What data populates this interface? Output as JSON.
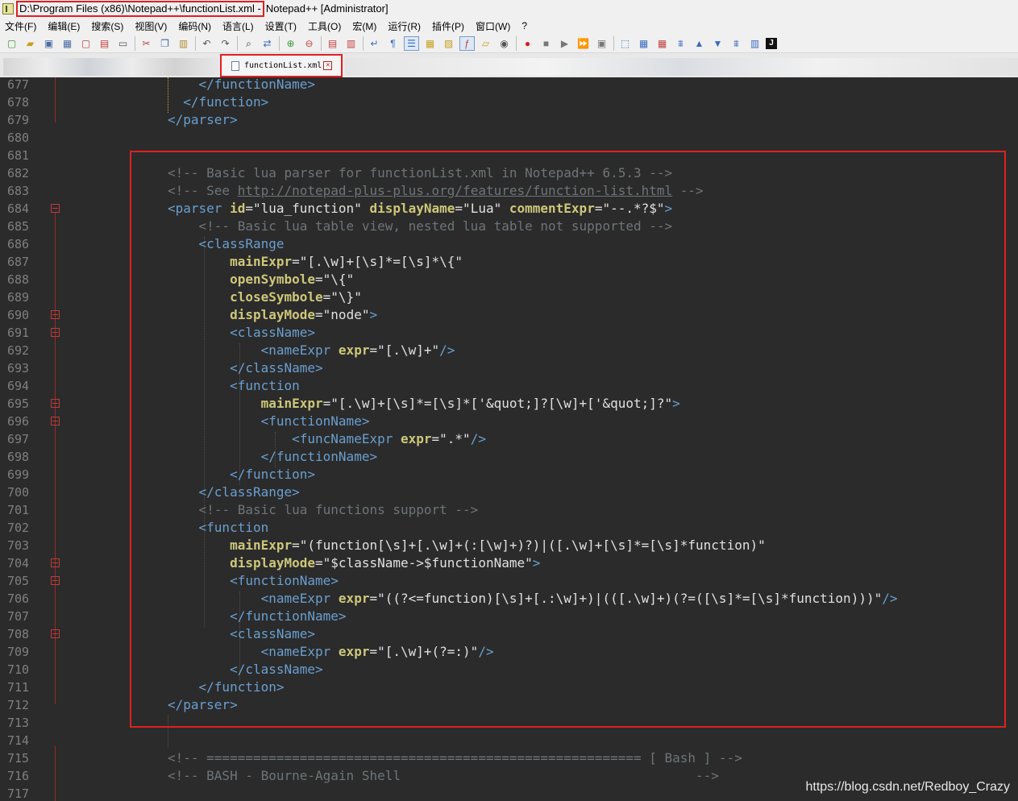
{
  "window": {
    "title_path": "D:\\Program Files (x86)\\Notepad++\\functionList.xml -",
    "title_rest": " Notepad++ [Administrator]"
  },
  "menu": [
    "文件(F)",
    "编辑(E)",
    "搜索(S)",
    "视图(V)",
    "编码(N)",
    "语言(L)",
    "设置(T)",
    "工具(O)",
    "宏(M)",
    "运行(R)",
    "插件(P)",
    "窗口(W)",
    "?"
  ],
  "tab": {
    "label": "functionList.xml"
  },
  "watermark": "https://blog.csdn.net/Redboy_Crazy",
  "lines": [
    {
      "n": "677",
      "code": [
        [
          "t",
          "    </functionName>"
        ]
      ]
    },
    {
      "n": "678",
      "code": [
        [
          "t",
          "  </function>"
        ]
      ]
    },
    {
      "n": "679",
      "code": [
        [
          "t",
          "</parser>"
        ]
      ]
    },
    {
      "n": "680",
      "code": []
    },
    {
      "n": "681",
      "code": []
    },
    {
      "n": "682",
      "code": [
        [
          "c",
          "<!-- Basic lua parser for functionList.xml in Notepad++ 6.5.3 -->"
        ]
      ]
    },
    {
      "n": "683",
      "code": [
        [
          "c",
          "<!-- See "
        ],
        [
          "cu",
          "http://notepad-plus-plus.org/features/function-list.html"
        ],
        [
          "c",
          " -->"
        ]
      ]
    },
    {
      "n": "684",
      "fold": true,
      "code": [
        [
          "t",
          "<parser "
        ],
        [
          "a",
          "id"
        ],
        [
          "v",
          "=\"lua_function\" "
        ],
        [
          "a",
          "displayName"
        ],
        [
          "v",
          "=\"Lua\" "
        ],
        [
          "a",
          "commentExpr"
        ],
        [
          "v",
          "=\"--.*?$\""
        ],
        [
          "t",
          ">"
        ]
      ]
    },
    {
      "n": "685",
      "code": [
        [
          "c",
          "    <!-- Basic lua table view, nested lua table not supported -->"
        ]
      ]
    },
    {
      "n": "686",
      "code": [
        [
          "t",
          "    <classRange"
        ]
      ]
    },
    {
      "n": "687",
      "code": [
        [
          "a",
          "        mainExpr"
        ],
        [
          "v",
          "=\"[.\\w]+[\\s]*=[\\s]*\\{\""
        ]
      ]
    },
    {
      "n": "688",
      "code": [
        [
          "a",
          "        openSymbole"
        ],
        [
          "v",
          "=\"\\{\""
        ]
      ]
    },
    {
      "n": "689",
      "code": [
        [
          "a",
          "        closeSymbole"
        ],
        [
          "v",
          "=\"\\}\""
        ]
      ]
    },
    {
      "n": "690",
      "fold": true,
      "code": [
        [
          "a",
          "        displayMode"
        ],
        [
          "v",
          "=\"node\""
        ],
        [
          "t",
          ">"
        ]
      ]
    },
    {
      "n": "691",
      "fold": true,
      "code": [
        [
          "t",
          "        <className>"
        ]
      ]
    },
    {
      "n": "692",
      "code": [
        [
          "t",
          "            <nameExpr "
        ],
        [
          "a",
          "expr"
        ],
        [
          "v",
          "=\"[.\\w]+\""
        ],
        [
          "t",
          "/>"
        ]
      ]
    },
    {
      "n": "693",
      "code": [
        [
          "t",
          "        </className>"
        ]
      ]
    },
    {
      "n": "694",
      "code": [
        [
          "t",
          "        <function"
        ]
      ]
    },
    {
      "n": "695",
      "fold": true,
      "code": [
        [
          "a",
          "            mainExpr"
        ],
        [
          "v",
          "=\"[.\\w]+[\\s]*=[\\s]*['&quot;]?[\\w]+['&quot;]?\""
        ],
        [
          "t",
          ">"
        ]
      ]
    },
    {
      "n": "696",
      "fold": true,
      "code": [
        [
          "t",
          "            <functionName>"
        ]
      ]
    },
    {
      "n": "697",
      "code": [
        [
          "t",
          "                <funcNameExpr "
        ],
        [
          "a",
          "expr"
        ],
        [
          "v",
          "=\".*\""
        ],
        [
          "t",
          "/>"
        ]
      ]
    },
    {
      "n": "698",
      "code": [
        [
          "t",
          "            </functionName>"
        ]
      ]
    },
    {
      "n": "699",
      "code": [
        [
          "t",
          "        </function>"
        ]
      ]
    },
    {
      "n": "700",
      "code": [
        [
          "t",
          "    </classRange>"
        ]
      ]
    },
    {
      "n": "701",
      "code": [
        [
          "c",
          "    <!-- Basic lua functions support -->"
        ]
      ]
    },
    {
      "n": "702",
      "code": [
        [
          "t",
          "    <function"
        ]
      ]
    },
    {
      "n": "703",
      "code": [
        [
          "a",
          "        mainExpr"
        ],
        [
          "v",
          "=\"(function[\\s]+[.\\w]+(:[\\w]+)?)|([.\\w]+[\\s]*=[\\s]*function)\""
        ]
      ]
    },
    {
      "n": "704",
      "fold": true,
      "code": [
        [
          "a",
          "        displayMode"
        ],
        [
          "v",
          "=\"$className->$functionName\""
        ],
        [
          "t",
          ">"
        ]
      ]
    },
    {
      "n": "705",
      "fold": true,
      "code": [
        [
          "t",
          "        <functionName>"
        ]
      ]
    },
    {
      "n": "706",
      "code": [
        [
          "t",
          "            <nameExpr "
        ],
        [
          "a",
          "expr"
        ],
        [
          "v",
          "=\"((?<=function)[\\s]+[.:\\w]+)|(([.\\w]+)(?=([\\s]*=[\\s]*function)))\""
        ],
        [
          "t",
          "/>"
        ]
      ]
    },
    {
      "n": "707",
      "code": [
        [
          "t",
          "        </functionName>"
        ]
      ]
    },
    {
      "n": "708",
      "fold": true,
      "code": [
        [
          "t",
          "        <className>"
        ]
      ]
    },
    {
      "n": "709",
      "code": [
        [
          "t",
          "            <nameExpr "
        ],
        [
          "a",
          "expr"
        ],
        [
          "v",
          "=\"[.\\w]+(?=:)\""
        ],
        [
          "t",
          "/>"
        ]
      ]
    },
    {
      "n": "710",
      "code": [
        [
          "t",
          "        </className>"
        ]
      ]
    },
    {
      "n": "711",
      "code": [
        [
          "t",
          "    </function>"
        ]
      ]
    },
    {
      "n": "712",
      "code": [
        [
          "t",
          "</parser>"
        ]
      ]
    },
    {
      "n": "713",
      "code": []
    },
    {
      "n": "714",
      "code": []
    },
    {
      "n": "715",
      "code": [
        [
          "c",
          "<!-- ======================================================== [ Bash ] -->"
        ]
      ]
    },
    {
      "n": "716",
      "code": [
        [
          "c",
          "<!-- BASH - Bourne-Again Shell                                      -->"
        ]
      ]
    },
    {
      "n": "717",
      "code": []
    }
  ]
}
